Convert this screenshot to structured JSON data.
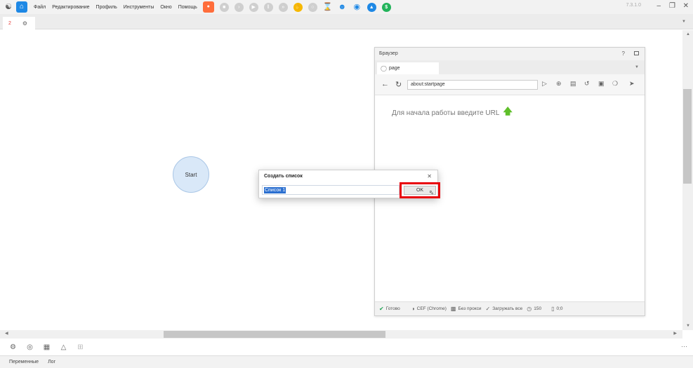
{
  "menubar": {
    "items": [
      "Файл",
      "Редактирование",
      "Профиль",
      "Инструменты",
      "Окно",
      "Помощь"
    ],
    "version": "7.3.1.0"
  },
  "doc_tab": {
    "label": "2"
  },
  "canvas": {
    "start_node_label": "Start"
  },
  "browser": {
    "title": "Браузер",
    "help": "?",
    "tab_label": "page",
    "url": "about:startpage",
    "hint": "Для начала работы введите URL",
    "status": {
      "ready": "Готово",
      "engine": "CEF (Chrome)",
      "proxy": "Без прокси",
      "load": "Загружать все",
      "count": "150",
      "coords": "0;0"
    }
  },
  "dialog": {
    "title": "Создать список",
    "input_value": "Список 1",
    "ok_label": "OK"
  },
  "bottom_panel": {
    "tabs": [
      "Переменные",
      "Лог"
    ]
  },
  "colors": {
    "accent": "#1e88e5",
    "record": "#ff6d3b",
    "highlight": "#e8000b",
    "start_node": "#d9e8f8"
  }
}
